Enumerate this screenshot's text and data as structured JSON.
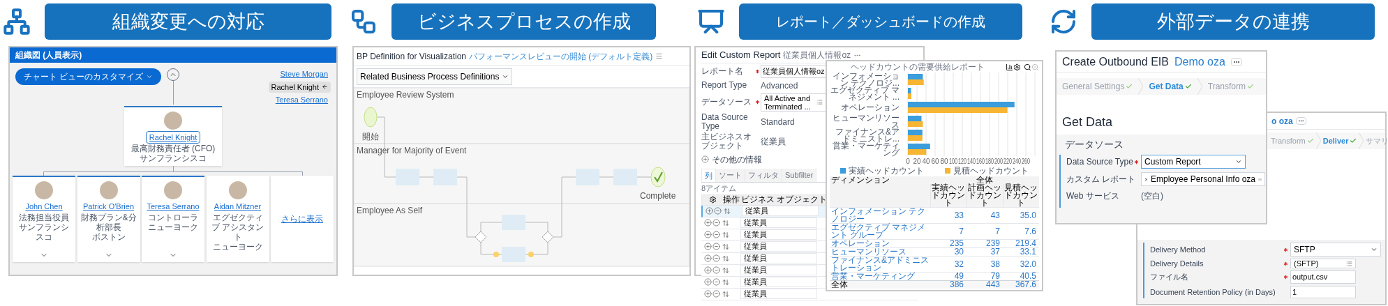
{
  "headers": [
    {
      "kind": "org",
      "title": "組織変更への対応"
    },
    {
      "kind": "process",
      "title": "ビジネスプロセスの作成"
    },
    {
      "kind": "report",
      "title": "レポート／ダッシュボードの作成"
    },
    {
      "kind": "sync",
      "title": "外部データの連携"
    }
  ],
  "org_chart": {
    "title": "組織図 (人員表示)",
    "customize_button": "チャート ビューのカスタマイズ",
    "breadcrumbs": [
      {
        "name": "Steve Morgan",
        "selected": false
      },
      {
        "name": "Rachel Knight",
        "selected": true
      },
      {
        "name": "Teresa Serrano",
        "selected": false
      }
    ],
    "manager": {
      "name": "Rachel Knight",
      "title": "最高財務責任者 (CFO)",
      "location": "サンフランシスコ"
    },
    "reports": [
      {
        "name": "John Chen",
        "title": "法務担当役員",
        "location": "サンフランシスコ",
        "expandable": true
      },
      {
        "name": "Patrick O'Brien",
        "title": "財務プラン&分析部長",
        "location": "ボストン",
        "expandable": true
      },
      {
        "name": "Teresa Serrano",
        "title": "コントローラ",
        "location": "ニューヨーク",
        "expandable": true
      },
      {
        "name": "Aidan Mitzner",
        "title": "エグゼクティブ アシスタント",
        "location": "ニューヨーク",
        "expandable": false
      }
    ],
    "more_link": "さらに表示"
  },
  "process": {
    "title": "BP Definition for Visualization",
    "subtitle": "パフォーマンスレビューの開始 (デフォルト定義)",
    "related_button": "Related Business Process Definitions",
    "lanes": [
      "Employee Review System",
      "Manager for Majority of Event",
      "Employee As Self"
    ],
    "start_label": "開始",
    "end_label": "Complete"
  },
  "report_editor": {
    "title": "Edit Custom Report",
    "report_name": "従業員個人情報oz",
    "fields": [
      {
        "label": "レポート名",
        "value": "従業員個人情報oz",
        "kind": "input",
        "required": true
      },
      {
        "label": "Report Type",
        "value": "Advanced",
        "kind": "text",
        "required": false
      },
      {
        "label": "データソース",
        "value": "All Active and Terminated ...",
        "kind": "prompt",
        "required": true
      },
      {
        "label": "Data Source Type",
        "value": "Standard",
        "kind": "text",
        "required": false
      },
      {
        "label": "主ビジネスオブジェクト",
        "value": "従業員",
        "kind": "text",
        "required": false
      }
    ],
    "section": "その他の情報",
    "tabs": [
      {
        "label": "列",
        "selected": true
      },
      {
        "label": "ソート",
        "selected": false
      },
      {
        "label": "フィルタ",
        "selected": false
      },
      {
        "label": "Subfilter",
        "selected": false
      }
    ],
    "items_count": "8アイテム",
    "columns": [
      "操作",
      "ビジネス オブジェクト"
    ],
    "rows": [
      {
        "object": "従業員",
        "selected": true
      },
      {
        "object": "従業員",
        "selected": false
      },
      {
        "object": "従業員",
        "selected": false
      },
      {
        "object": "従業員",
        "selected": false
      },
      {
        "object": "従業員",
        "selected": false
      },
      {
        "object": "従業員",
        "selected": false
      },
      {
        "object": "従業員",
        "selected": false
      },
      {
        "object": "従業員",
        "selected": false
      }
    ]
  },
  "headcount_report": {
    "title": "ヘッドカウントの需要供給レポート",
    "chart_data": {
      "type": "bar",
      "orientation": "horizontal",
      "grid": true,
      "categories": [
        "インフォメーション テクノロジ...",
        "エグゼクティブ マネジメント ...",
        "オペレーション",
        "ヒューマンリソース",
        "ファイナンス&アドミニストレ...",
        "営業・マーケティング"
      ],
      "series": [
        {
          "name": "実績ヘッドカウント",
          "color": "#3b9ddb",
          "values": [
            33,
            7,
            235,
            30,
            32,
            49
          ]
        },
        {
          "name": "見積ヘッドカウント",
          "color": "#f6b533",
          "values": [
            35.0,
            7.6,
            219.4,
            33.1,
            32.0,
            40.5
          ]
        }
      ],
      "xlim": [
        0,
        280
      ],
      "xticks": [
        0,
        20,
        40,
        60,
        80,
        100,
        120,
        140,
        160,
        180,
        200,
        220,
        240,
        260
      ]
    },
    "table": {
      "dimension_header": "ディメンション",
      "group_header": "全体",
      "columns": [
        "実績ヘッドカウント",
        "計画ヘッドカウント",
        "見積ヘッドカウント"
      ],
      "rows": [
        {
          "dimension": "インフォメーション テクノロジー",
          "values": [
            "33",
            "43",
            "35.0"
          ]
        },
        {
          "dimension": "エグゼクティブ マネジメント グループ",
          "values": [
            "7",
            "7",
            "7.6"
          ]
        },
        {
          "dimension": "オペレーション",
          "values": [
            "235",
            "239",
            "219.4"
          ]
        },
        {
          "dimension": "ヒューマンリソース",
          "values": [
            "30",
            "37",
            "33.1"
          ]
        },
        {
          "dimension": "ファイナンス&アドミニストレーション",
          "values": [
            "32",
            "38",
            "32.0"
          ]
        },
        {
          "dimension": "営業・マーケティング",
          "values": [
            "49",
            "79",
            "40.5"
          ]
        }
      ],
      "total": {
        "dimension": "全体",
        "values": [
          "386",
          "443",
          "367.6"
        ]
      }
    }
  },
  "eib": {
    "title": "Create Outbound EIB",
    "name": "Demo oza",
    "steps": [
      {
        "label": "General Settings",
        "selected": false,
        "done": true
      },
      {
        "label": "Get Data",
        "selected": true,
        "done": true
      },
      {
        "label": "Transform",
        "selected": false,
        "done": true
      }
    ],
    "heading": "Get Data",
    "section": "データソース",
    "fields": [
      {
        "label": "Data Source Type",
        "value": "Custom Report",
        "kind": "dropdown",
        "required": true
      },
      {
        "label": "カスタム レポート",
        "value": "Employee Personal Info oza",
        "kind": "prompt",
        "required": false
      },
      {
        "label": "Web サービス",
        "value": "(空白)",
        "kind": "text",
        "required": false
      }
    ]
  },
  "eib_deliver": {
    "name": "o oza",
    "steps": [
      {
        "label": "Transform",
        "selected": false,
        "done": true
      },
      {
        "label": "Deliver",
        "selected": true,
        "done": true
      },
      {
        "label": "サマリ",
        "selected": false,
        "done": false
      }
    ],
    "fields": [
      {
        "label": "Delivery Method",
        "value": "SFTP",
        "kind": "dropdown",
        "required": true
      },
      {
        "label": "Delivery Details",
        "value": "(SFTP)",
        "kind": "prompt",
        "required": true
      },
      {
        "label": "ファイル名",
        "value": "output.csv",
        "kind": "input",
        "required": true
      },
      {
        "label": "Document Retention Policy (in Days)",
        "value": "1",
        "kind": "input",
        "required": false
      }
    ]
  }
}
